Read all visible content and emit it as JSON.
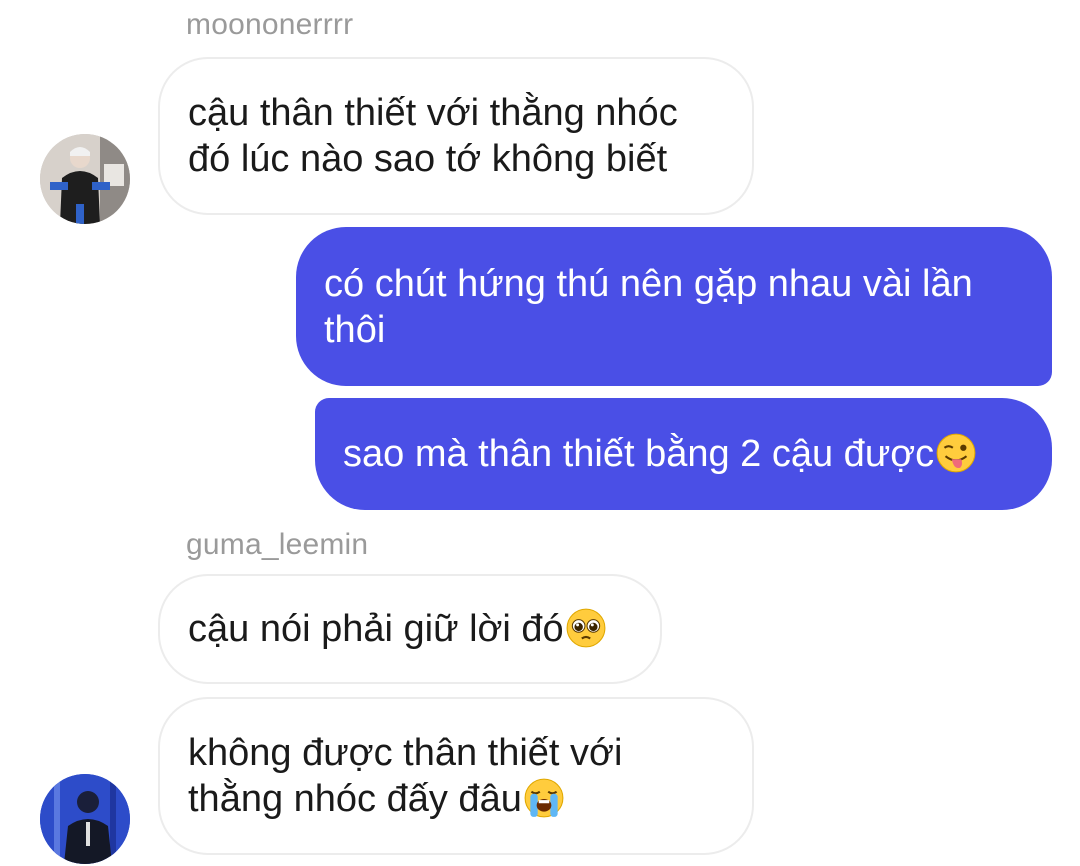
{
  "messages": [
    {
      "sender": "moononerrrr",
      "text": "cậu thân thiết với thằng nhóc đó lúc nào sao tớ không biết"
    },
    {
      "text": "có chút hứng thú nên gặp nhau vài lần thôi"
    },
    {
      "text": "sao mà thân thiết bằng 2 cậu được",
      "emoji": "winking-face-with-tongue"
    },
    {
      "sender": "guma_leemin",
      "text": "cậu nói phải giữ lời đó",
      "emoji": "pleading-face"
    },
    {
      "text": "không được thân thiết với thằng nhóc đấy đâu",
      "emoji": "loudly-crying-face"
    }
  ],
  "colors": {
    "outgoing_bubble": "#4a4fe6",
    "incoming_bubble": "#ffffff",
    "incoming_border": "#ececec",
    "sender_name": "#9a9a9a"
  }
}
